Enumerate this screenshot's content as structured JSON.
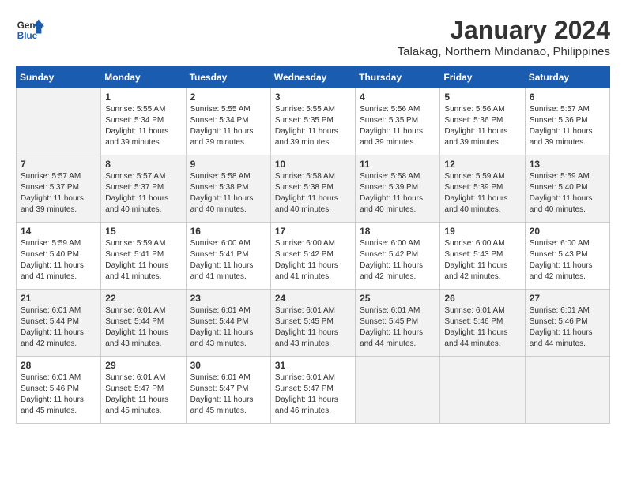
{
  "header": {
    "logo_general": "General",
    "logo_blue": "Blue",
    "month": "January 2024",
    "location": "Talakag, Northern Mindanao, Philippines"
  },
  "days_of_week": [
    "Sunday",
    "Monday",
    "Tuesday",
    "Wednesday",
    "Thursday",
    "Friday",
    "Saturday"
  ],
  "weeks": [
    [
      {
        "day": "",
        "content": ""
      },
      {
        "day": "1",
        "content": "Sunrise: 5:55 AM\nSunset: 5:34 PM\nDaylight: 11 hours\nand 39 minutes."
      },
      {
        "day": "2",
        "content": "Sunrise: 5:55 AM\nSunset: 5:34 PM\nDaylight: 11 hours\nand 39 minutes."
      },
      {
        "day": "3",
        "content": "Sunrise: 5:55 AM\nSunset: 5:35 PM\nDaylight: 11 hours\nand 39 minutes."
      },
      {
        "day": "4",
        "content": "Sunrise: 5:56 AM\nSunset: 5:35 PM\nDaylight: 11 hours\nand 39 minutes."
      },
      {
        "day": "5",
        "content": "Sunrise: 5:56 AM\nSunset: 5:36 PM\nDaylight: 11 hours\nand 39 minutes."
      },
      {
        "day": "6",
        "content": "Sunrise: 5:57 AM\nSunset: 5:36 PM\nDaylight: 11 hours\nand 39 minutes."
      }
    ],
    [
      {
        "day": "7",
        "content": "Sunrise: 5:57 AM\nSunset: 5:37 PM\nDaylight: 11 hours\nand 39 minutes."
      },
      {
        "day": "8",
        "content": "Sunrise: 5:57 AM\nSunset: 5:37 PM\nDaylight: 11 hours\nand 40 minutes."
      },
      {
        "day": "9",
        "content": "Sunrise: 5:58 AM\nSunset: 5:38 PM\nDaylight: 11 hours\nand 40 minutes."
      },
      {
        "day": "10",
        "content": "Sunrise: 5:58 AM\nSunset: 5:38 PM\nDaylight: 11 hours\nand 40 minutes."
      },
      {
        "day": "11",
        "content": "Sunrise: 5:58 AM\nSunset: 5:39 PM\nDaylight: 11 hours\nand 40 minutes."
      },
      {
        "day": "12",
        "content": "Sunrise: 5:59 AM\nSunset: 5:39 PM\nDaylight: 11 hours\nand 40 minutes."
      },
      {
        "day": "13",
        "content": "Sunrise: 5:59 AM\nSunset: 5:40 PM\nDaylight: 11 hours\nand 40 minutes."
      }
    ],
    [
      {
        "day": "14",
        "content": "Sunrise: 5:59 AM\nSunset: 5:40 PM\nDaylight: 11 hours\nand 41 minutes."
      },
      {
        "day": "15",
        "content": "Sunrise: 5:59 AM\nSunset: 5:41 PM\nDaylight: 11 hours\nand 41 minutes."
      },
      {
        "day": "16",
        "content": "Sunrise: 6:00 AM\nSunset: 5:41 PM\nDaylight: 11 hours\nand 41 minutes."
      },
      {
        "day": "17",
        "content": "Sunrise: 6:00 AM\nSunset: 5:42 PM\nDaylight: 11 hours\nand 41 minutes."
      },
      {
        "day": "18",
        "content": "Sunrise: 6:00 AM\nSunset: 5:42 PM\nDaylight: 11 hours\nand 42 minutes."
      },
      {
        "day": "19",
        "content": "Sunrise: 6:00 AM\nSunset: 5:43 PM\nDaylight: 11 hours\nand 42 minutes."
      },
      {
        "day": "20",
        "content": "Sunrise: 6:00 AM\nSunset: 5:43 PM\nDaylight: 11 hours\nand 42 minutes."
      }
    ],
    [
      {
        "day": "21",
        "content": "Sunrise: 6:01 AM\nSunset: 5:44 PM\nDaylight: 11 hours\nand 42 minutes."
      },
      {
        "day": "22",
        "content": "Sunrise: 6:01 AM\nSunset: 5:44 PM\nDaylight: 11 hours\nand 43 minutes."
      },
      {
        "day": "23",
        "content": "Sunrise: 6:01 AM\nSunset: 5:44 PM\nDaylight: 11 hours\nand 43 minutes."
      },
      {
        "day": "24",
        "content": "Sunrise: 6:01 AM\nSunset: 5:45 PM\nDaylight: 11 hours\nand 43 minutes."
      },
      {
        "day": "25",
        "content": "Sunrise: 6:01 AM\nSunset: 5:45 PM\nDaylight: 11 hours\nand 44 minutes."
      },
      {
        "day": "26",
        "content": "Sunrise: 6:01 AM\nSunset: 5:46 PM\nDaylight: 11 hours\nand 44 minutes."
      },
      {
        "day": "27",
        "content": "Sunrise: 6:01 AM\nSunset: 5:46 PM\nDaylight: 11 hours\nand 44 minutes."
      }
    ],
    [
      {
        "day": "28",
        "content": "Sunrise: 6:01 AM\nSunset: 5:46 PM\nDaylight: 11 hours\nand 45 minutes."
      },
      {
        "day": "29",
        "content": "Sunrise: 6:01 AM\nSunset: 5:47 PM\nDaylight: 11 hours\nand 45 minutes."
      },
      {
        "day": "30",
        "content": "Sunrise: 6:01 AM\nSunset: 5:47 PM\nDaylight: 11 hours\nand 45 minutes."
      },
      {
        "day": "31",
        "content": "Sunrise: 6:01 AM\nSunset: 5:47 PM\nDaylight: 11 hours\nand 46 minutes."
      },
      {
        "day": "",
        "content": ""
      },
      {
        "day": "",
        "content": ""
      },
      {
        "day": "",
        "content": ""
      }
    ]
  ]
}
